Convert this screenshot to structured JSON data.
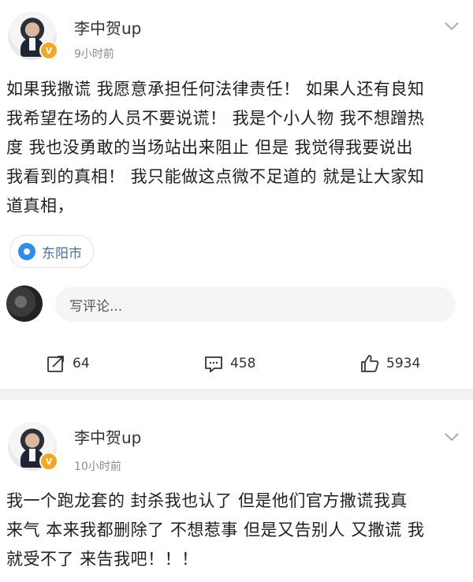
{
  "posts": [
    {
      "username": "李中贺up",
      "time": "9小时前",
      "content": "如果我撒谎 我愿意承担任何法律责任！ 如果人还有良知\n我希望在场的人员不要说谎！ 我是个小人物 我不想蹭热\n度 我也没勇敢的当场站出来阻止 但是 我觉得我要说出\n我看到的真相！ 我只能做这点微不足道的 就是让大家知\n道真相，",
      "location": "东阳市",
      "comment_placeholder": "写评论...",
      "actions": {
        "repost": "64",
        "comment": "458",
        "like": "5934"
      }
    },
    {
      "username": "李中贺up",
      "time": "10小时前",
      "content": "我一个跑龙套的 封杀我也认了 但是他们官方撒谎我真\n来气 本来我都删除了 不想惹事 但是又告别人 又撒谎 我\n就受不了 来告我吧！！！"
    }
  ],
  "icons": {
    "verified": "verified-badge-icon",
    "chevron": "chevron-down-icon",
    "location": "location-pin-icon",
    "repost": "repost-icon",
    "comment": "comment-icon",
    "like": "like-icon"
  },
  "colors": {
    "verified": "#f5a623",
    "location_pin": "#2e8cf0",
    "location_text": "#4a6fa5",
    "separator": "#f2f2f2"
  }
}
